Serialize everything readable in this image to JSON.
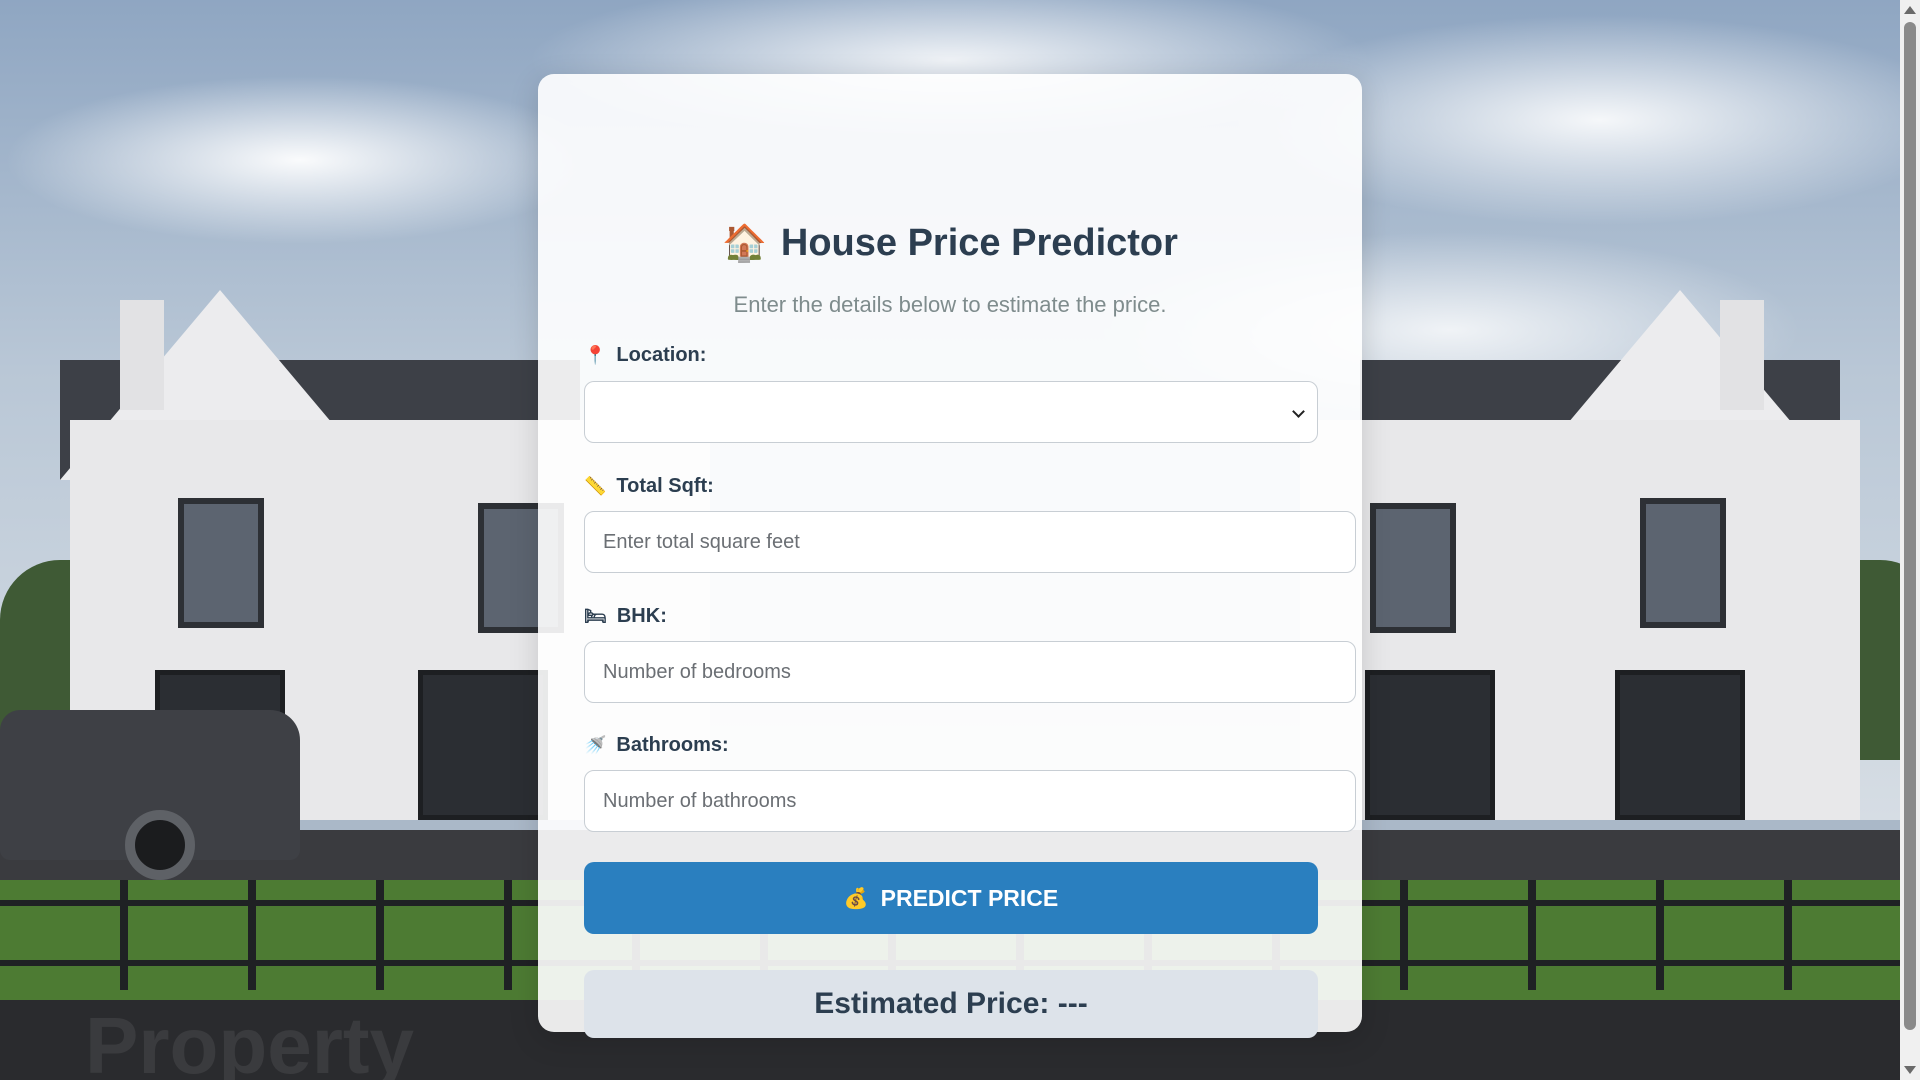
{
  "page": {
    "title": "House Price Predictor",
    "title_icon": "house-icon",
    "subtitle": "Enter the details below to estimate the price."
  },
  "form": {
    "location": {
      "icon": "pin-icon",
      "label": "Location:",
      "value": ""
    },
    "sqft": {
      "icon": "ruler-icon",
      "label": "Total Sqft:",
      "placeholder": "Enter total square feet",
      "value": ""
    },
    "bhk": {
      "icon": "bed-icon",
      "label": "BHK:",
      "placeholder": "Number of bedrooms",
      "value": ""
    },
    "bath": {
      "icon": "shower-icon",
      "label": "Bathrooms:",
      "placeholder": "Number of bathrooms",
      "value": ""
    },
    "submit": {
      "icon": "money-bag-icon",
      "label": "PREDICT PRICE"
    }
  },
  "result": {
    "label": "Estimated Price:",
    "value": "---"
  },
  "background": {
    "watermark": "Property"
  },
  "colors": {
    "accent": "#2a7fbf",
    "title": "#2c3e50",
    "subtitle": "#7f8c8d",
    "result_bg": "#dde3ea"
  }
}
